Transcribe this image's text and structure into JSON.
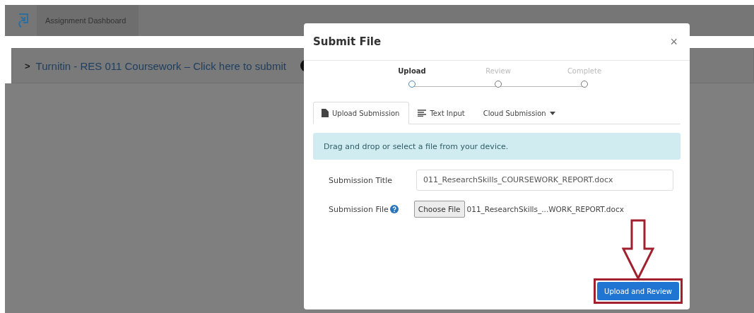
{
  "page": {
    "tab": "Assignment Dashboard",
    "assignment_link": "Turnitin - RES 011 Coursework – Click here to submit",
    "expand_glyph": ">"
  },
  "dialog": {
    "title": "Submit File",
    "close": "×",
    "steps": [
      {
        "label": "Upload",
        "selected": true
      },
      {
        "label": "Review",
        "selected": false
      },
      {
        "label": "Complete",
        "selected": false
      }
    ],
    "tabs": [
      {
        "label": "Upload Submission",
        "kind": "file",
        "selected": true
      },
      {
        "label": "Text Input",
        "kind": "text",
        "selected": false
      },
      {
        "label": "Cloud Submission",
        "kind": "dropdown",
        "selected": false
      }
    ],
    "info": "Drag and drop or select a file from your device.",
    "title_label": "Submission Title",
    "title_value": "011_ResearchSkills_COURSEWORK_REPORT.docx",
    "file_label": "Submission File",
    "choose_button": "Choose File",
    "file_name": "011_ResearchSkills_...WORK_REPORT.docx",
    "submit_button": "Upload and Review"
  }
}
